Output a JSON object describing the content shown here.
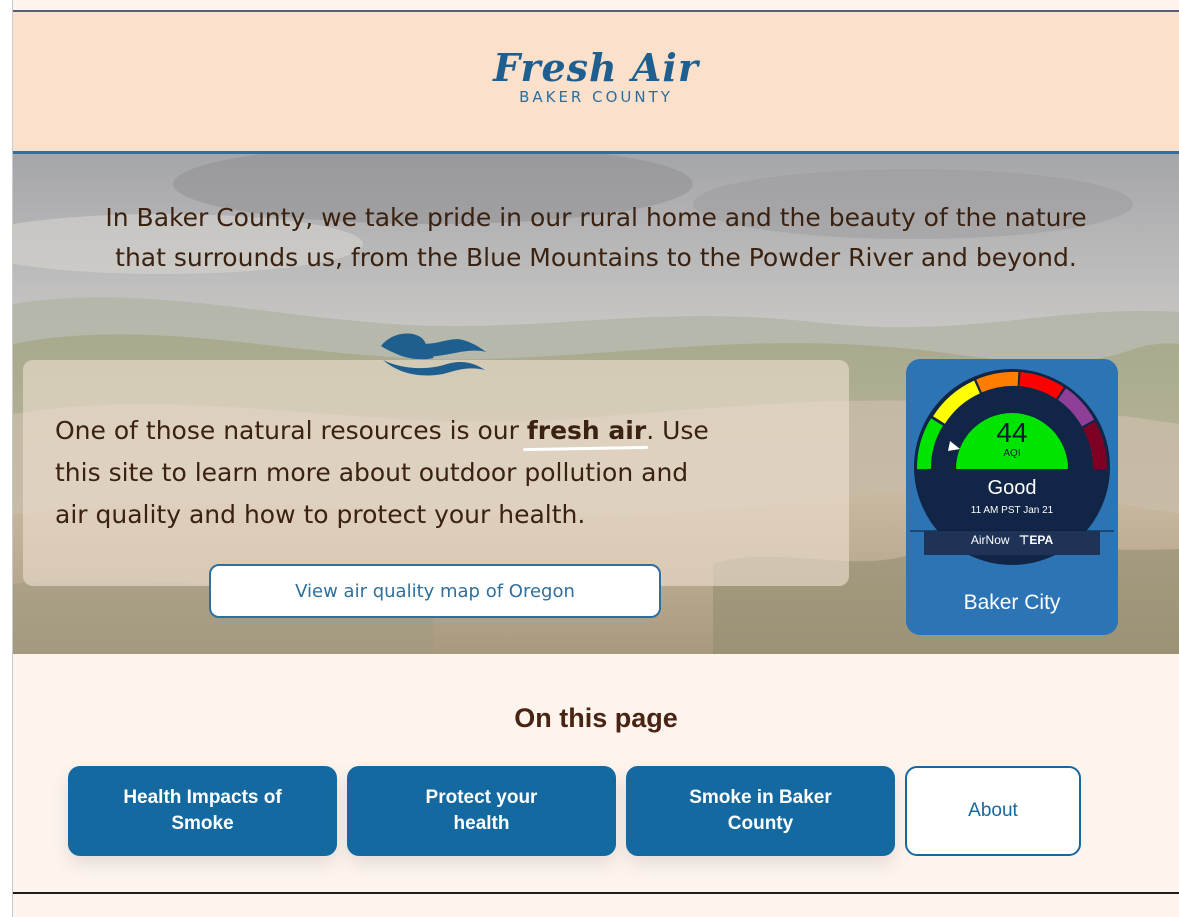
{
  "header": {
    "logo_script": "Fresh Air",
    "logo_sub": "BAKER COUNTY"
  },
  "hero": {
    "intro_line1": "In Baker County, we take pride in our rural home and the beauty of the nature",
    "intro_line2": "that surrounds us, from the Blue Mountains to the Powder River and beyond.",
    "card_text_before": "One of those natural resources is our ",
    "card_highlight": "fresh air",
    "card_text_after_line1": ". Use",
    "card_text_line2": "this site to learn more about outdoor pollution and",
    "card_text_line3": "air quality  and how to protect your health.",
    "map_button_label": "View air quality map of Oregon"
  },
  "aqi_widget": {
    "value": "44",
    "unit": "AQI",
    "status": "Good",
    "timestamp": "11 AM PST Jan 21",
    "source": "AirNow",
    "agency": "EPA",
    "city": "Baker City",
    "colors": {
      "good": "#00e400",
      "moderate": "#ffff00",
      "usg": "#ff7e00",
      "unhealthy": "#ff0000",
      "very_unhealthy": "#8f3f97",
      "hazardous": "#7e0023"
    }
  },
  "on_this_page": {
    "title": "On this page",
    "links": [
      {
        "line1": "Health Impacts of",
        "line2": "Smoke"
      },
      {
        "line1": "Protect your",
        "line2": "health"
      },
      {
        "line1": "Smoke in Baker",
        "line2": "County"
      },
      {
        "line1": "About",
        "line2": ""
      }
    ]
  },
  "icons": [
    "wave-icon",
    "dial-pointer-icon",
    "epa-logo-icon"
  ]
}
